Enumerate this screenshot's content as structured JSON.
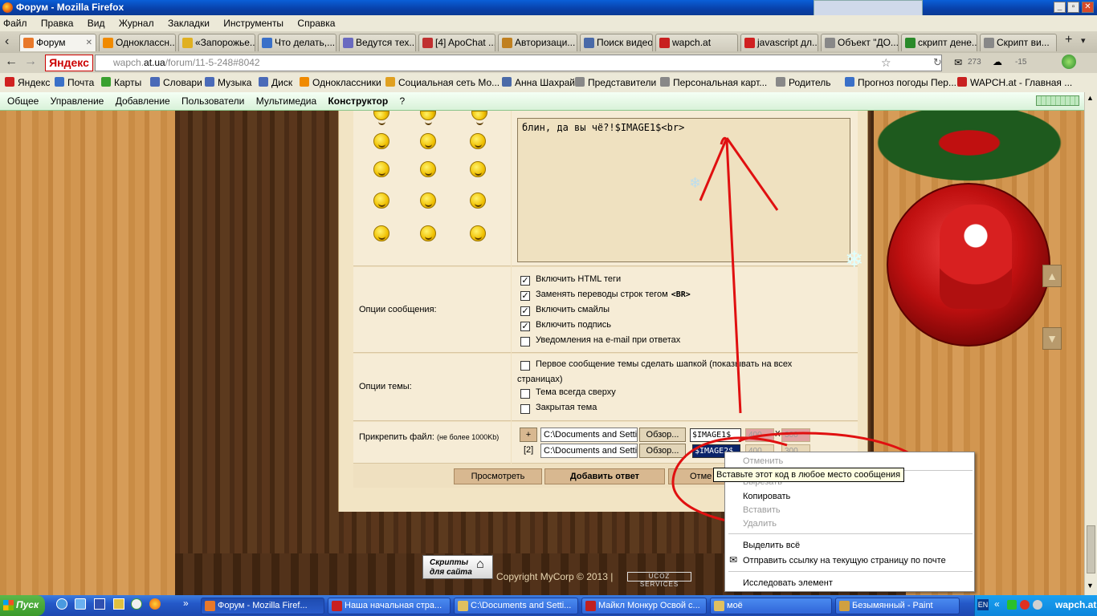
{
  "window": {
    "title": "Форум - Mozilla Firefox"
  },
  "menu": [
    "Файл",
    "Правка",
    "Вид",
    "Журнал",
    "Закладки",
    "Инструменты",
    "Справка"
  ],
  "tabs": [
    {
      "label": "Форум",
      "color": "#e8782a"
    },
    {
      "label": "Одноклассн...",
      "color": "#f08a00"
    },
    {
      "label": "«Запорожье...",
      "color": "#e0b020"
    },
    {
      "label": "Что делать,...",
      "color": "#3a70c8"
    },
    {
      "label": "Ведутся тех...",
      "color": "#6a6ac0"
    },
    {
      "label": "[4] ApoChat ...",
      "color": "#c03030"
    },
    {
      "label": "Авторизаци...",
      "color": "#c08020"
    },
    {
      "label": "Поиск видео...",
      "color": "#4a6aa8"
    },
    {
      "label": "wapch.at",
      "color": "#c82020"
    },
    {
      "label": "javascript дл...",
      "color": "#d02020"
    },
    {
      "label": "Объект \"ДО...",
      "color": "#888888"
    },
    {
      "label": "скрипт дене...",
      "color": "#2a8a2a"
    },
    {
      "label": "Скрипт ви...",
      "color": "#888888"
    }
  ],
  "nav": {
    "yandex_logo": "Яндекс",
    "url_prefix": "wapch.",
    "url_host": "at.ua",
    "url_path": "/forum/11-5-248#8042",
    "mail_count": "273",
    "weather": "-15"
  },
  "bookmarks": [
    {
      "label": "Яндекс",
      "color": "#d02020"
    },
    {
      "label": "Почта",
      "color": "#3a70c8"
    },
    {
      "label": "Карты",
      "color": "#3aa030"
    },
    {
      "label": "Словари",
      "color": "#4a6ab8"
    },
    {
      "label": "Музыка",
      "color": "#4a6ab8"
    },
    {
      "label": "Диск",
      "color": "#4a6ab8"
    },
    {
      "label": "Одноклассники",
      "color": "#f08a00"
    },
    {
      "label": "Социальная сеть Мо...",
      "color": "#e0a020"
    },
    {
      "label": "Анна Шахрай",
      "color": "#4a6aa8"
    },
    {
      "label": "Представители",
      "color": "#888888"
    },
    {
      "label": "Персональная карт...",
      "color": "#888888"
    },
    {
      "label": "Родитель",
      "color": "#888888"
    },
    {
      "label": "Прогноз погоды Пер...",
      "color": "#3a70c8"
    },
    {
      "label": "WAPCH.at - Главная ...",
      "color": "#c82020"
    }
  ],
  "admin_bar": [
    "Общее",
    "Управление",
    "Добавление",
    "Пользователи",
    "Мультимедиа",
    "Конструктор",
    "?"
  ],
  "form": {
    "message_text": "блин, да вы чё?!$IMAGE1$<br>",
    "message_options_label": "Опции сообщения:",
    "message_options": [
      {
        "label": "Включить HTML теги",
        "checked": true
      },
      {
        "label": "Заменять переводы строк тегом",
        "bold_suffix": "<BR>",
        "checked": true
      },
      {
        "label": "Включить смайлы",
        "checked": true
      },
      {
        "label": "Включить подпись",
        "checked": true
      },
      {
        "label": "Уведомления на e-mail при ответах",
        "checked": false
      }
    ],
    "topic_options_label": "Опции темы:",
    "topic_options": [
      {
        "label": "Первое сообщение темы сделать шапкой (показывать на всех",
        "continuation": "страницах)",
        "checked": false
      },
      {
        "label": "Тема всегда сверху",
        "checked": false
      },
      {
        "label": "Закрытая тема",
        "checked": false
      }
    ],
    "attach_label": "Прикрепить файл:",
    "attach_note": "(не более 1000Kb)",
    "attach_rows": [
      {
        "index": "+",
        "path": "C:\\Documents and Setti",
        "browse": "Обзор...",
        "code": "$IMAGE1$",
        "w": "400",
        "h": "300"
      },
      {
        "index": "[2]",
        "path": "C:\\Documents and Setti",
        "browse": "Обзор...",
        "code": "$IMAGE2$",
        "w": "400",
        "h": "300"
      }
    ],
    "buttons": {
      "preview": "Просмотреть",
      "submit": "Добавить ответ",
      "cancel": "Отме"
    }
  },
  "context_menu": {
    "items": [
      {
        "label": "Отменить",
        "enabled": false
      },
      {
        "label": "Вырезать",
        "enabled": false
      },
      {
        "label": "Копировать",
        "enabled": true
      },
      {
        "label": "Вставить",
        "enabled": false
      },
      {
        "label": "Удалить",
        "enabled": false
      },
      {
        "label": "Выделить всё",
        "enabled": true
      },
      {
        "label": "Отправить ссылку на текущую страницу по почте",
        "enabled": true
      },
      {
        "label": "Исследовать элемент",
        "enabled": true
      }
    ],
    "tooltip": "Вставьте этот код в любое место сообщения"
  },
  "footer": {
    "scripts_badge_line1": "Скрипты",
    "scripts_badge_line2": "для сайта",
    "copyright": "Copyright MyCorp © 2013 |",
    "ucoz": "UCOZ SERVICES"
  },
  "taskbar": {
    "start": "Пуск",
    "tasks": [
      {
        "label": "Форум - Mozilla Firef...",
        "color": "#e8782a",
        "active": true
      },
      {
        "label": "Наша начальная стра...",
        "color": "#c82020",
        "active": false
      },
      {
        "label": "C:\\Documents and Setti...",
        "color": "#e0c060",
        "active": false
      },
      {
        "label": "Майкл Монкур Освой с...",
        "color": "#c02020",
        "active": false
      },
      {
        "label": "моё",
        "color": "#e0c060",
        "active": false
      },
      {
        "label": "Безымянный - Paint",
        "color": "#d0a040",
        "active": false
      }
    ],
    "lang": "EN",
    "clock": "wapch.at"
  },
  "colors": {
    "annotation": "#e01010",
    "taskbar": "#2458c8",
    "titlebar": "#0840a8"
  }
}
